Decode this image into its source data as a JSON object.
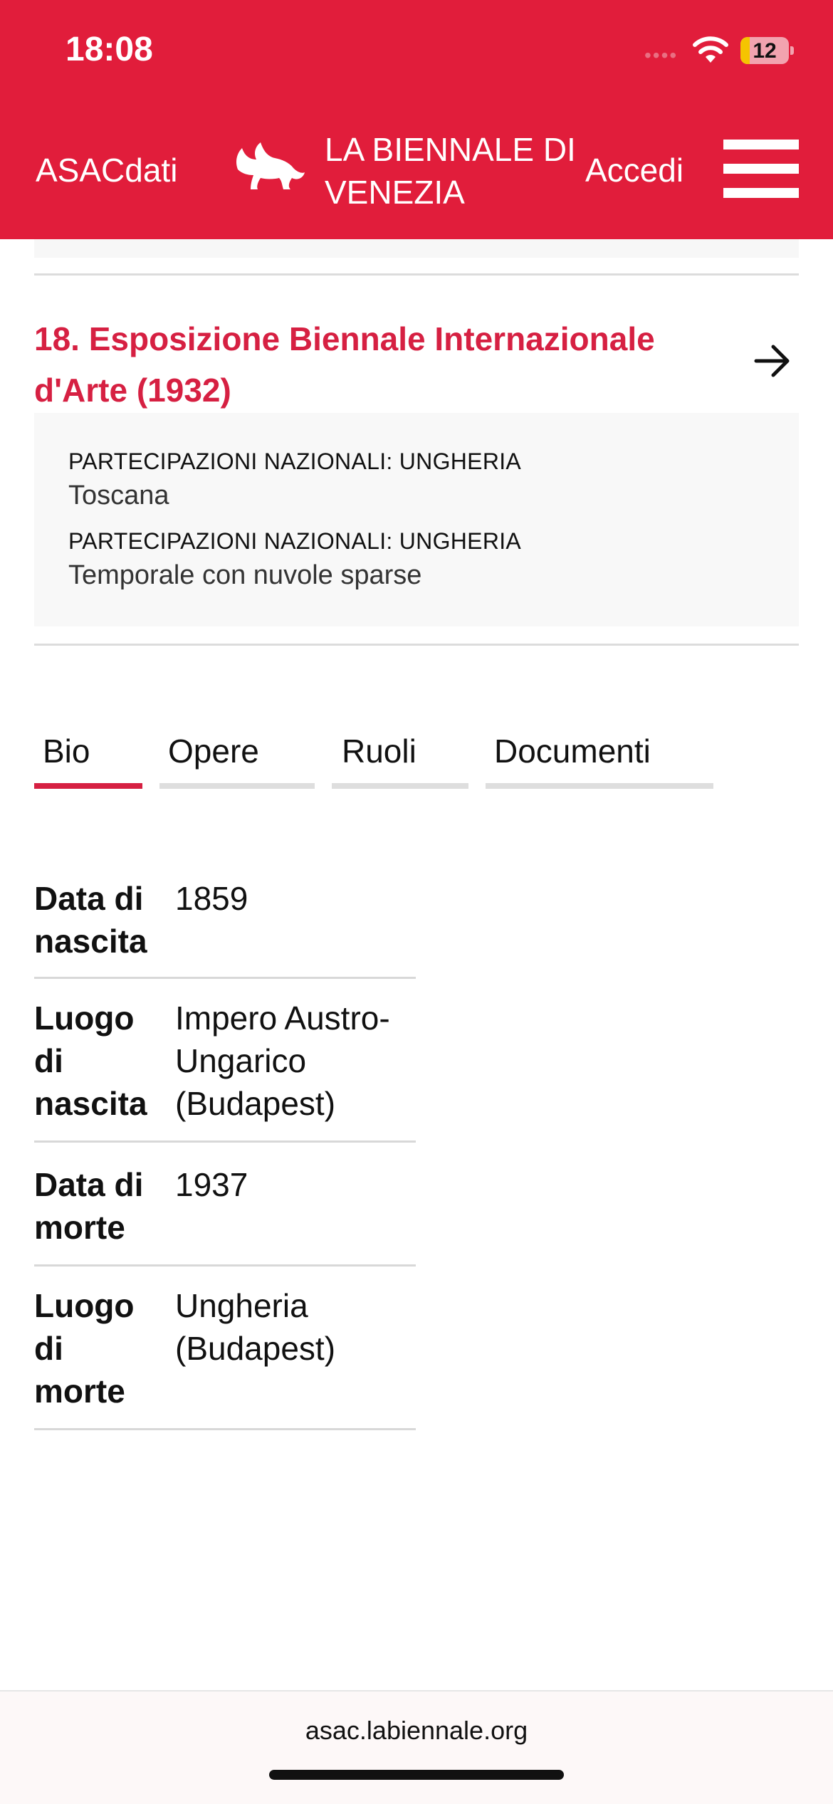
{
  "status": {
    "time": "18:08",
    "battery": "12"
  },
  "header": {
    "app_name": "ASACdati",
    "brand_title": "LA BIENNALE DI VENEZIA",
    "login_label": "Accedi"
  },
  "exhibition": {
    "title": "18. Esposizione Biennale Internazionale d'Arte (1932)",
    "items": [
      {
        "category": "PARTECIPAZIONI NAZIONALI: UNGHERIA",
        "work": "Toscana"
      },
      {
        "category": "PARTECIPAZIONI NAZIONALI: UNGHERIA",
        "work": "Temporale con nuvole sparse"
      }
    ]
  },
  "tabs": [
    {
      "label": "Bio",
      "active": true
    },
    {
      "label": "Opere",
      "active": false
    },
    {
      "label": "Ruoli",
      "active": false
    },
    {
      "label": "Documenti",
      "active": false
    }
  ],
  "bio": [
    {
      "label": "Data di nascita",
      "value": "1859"
    },
    {
      "label": "Luogo di nascita",
      "value": "Impero Austro-Ungarico (Budapest)"
    },
    {
      "label": "Data di morte",
      "value": "1937"
    },
    {
      "label": "Luogo di morte",
      "value": "Ungheria (Budapest)"
    }
  ],
  "browser": {
    "url": "asac.labiennale.org"
  },
  "colors": {
    "brand_red": "#e11d3b",
    "accent_red": "#d62042"
  }
}
